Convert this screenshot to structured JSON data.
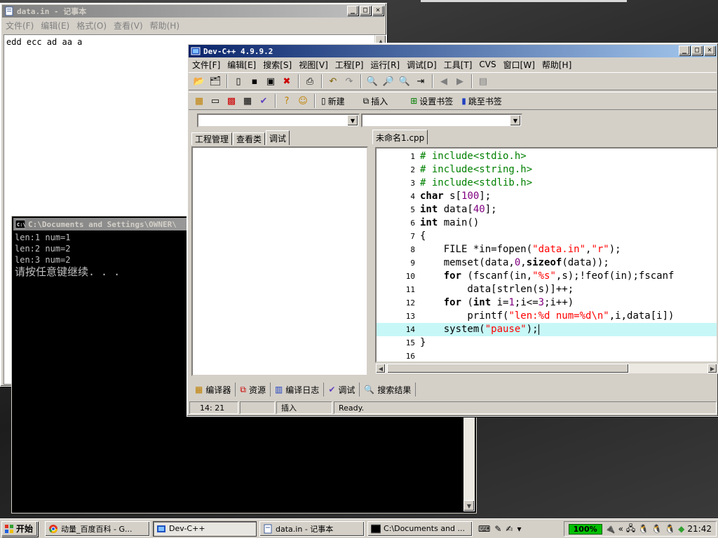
{
  "colors": {
    "titlebar_active": "#0a246a",
    "editor_highlight": "#c7f7f7",
    "preprocessor": "#008000",
    "string": "#ff0000",
    "number": "#800080"
  },
  "notepad": {
    "title": "data.in - 记事本",
    "menu": [
      "文件(F)",
      "编辑(E)",
      "格式(O)",
      "查看(V)",
      "帮助(H)"
    ],
    "content": "edd ecc ad aa a"
  },
  "console": {
    "title": "C:\\Documents and Settings\\OWNER\\",
    "lines": [
      "len:1 num=1",
      "len:2 num=2",
      "len:3 num=2"
    ],
    "prompt": "请按任意键继续. . ."
  },
  "devcpp": {
    "title": "Dev-C++ 4.9.9.2",
    "menu": [
      "文件[F]",
      "编辑[E]",
      "搜索[S]",
      "视图[V]",
      "工程[P]",
      "运行[R]",
      "调试[D]",
      "工具[T]",
      "CVS",
      "窗口[W]",
      "帮助[H]"
    ],
    "toolbar2_labels": {
      "new": "新建",
      "insert": "插入",
      "set_bookmark": "设置书签",
      "goto_bookmark": "跳至书签"
    },
    "left_tabs": [
      "工程管理",
      "查看类",
      "调试"
    ],
    "file_tab": "未命名1.cpp",
    "code_lines": [
      "# include<stdio.h>",
      "# include<string.h>",
      "# include<stdlib.h>",
      "char s[100];",
      "int data[40];",
      "int main()",
      "{",
      "    FILE *in=fopen(\"data.in\",\"r\");",
      "    memset(data,0,sizeof(data));",
      "    for (fscanf(in,\"%s\",s);!feof(in);fscanf",
      "        data[strlen(s)]++;",
      "    for (int i=1;i<=3;i++)",
      "        printf(\"len:%d num=%d\\n\",i,data[i])",
      "    system(\"pause\");",
      "}",
      ""
    ],
    "line_numbers": [
      "1",
      "2",
      "3",
      "4",
      "5",
      "6",
      "7",
      "8",
      "9",
      "10",
      "11",
      "12",
      "13",
      "14",
      "15",
      "16"
    ],
    "highlighted_line": 14,
    "bottom_tabs": [
      "编译器",
      "资源",
      "编译日志",
      "调试",
      "搜索结果"
    ],
    "status": {
      "position": "14: 21",
      "mode": "插入",
      "message": "Ready."
    }
  },
  "taskbar": {
    "start": "开始",
    "tasks": [
      "动量_百度百科 - G...",
      "Dev-C++",
      "data.in - 记事本",
      "C:\\Documents and ..."
    ],
    "battery": "100%",
    "clock": "21:42"
  }
}
